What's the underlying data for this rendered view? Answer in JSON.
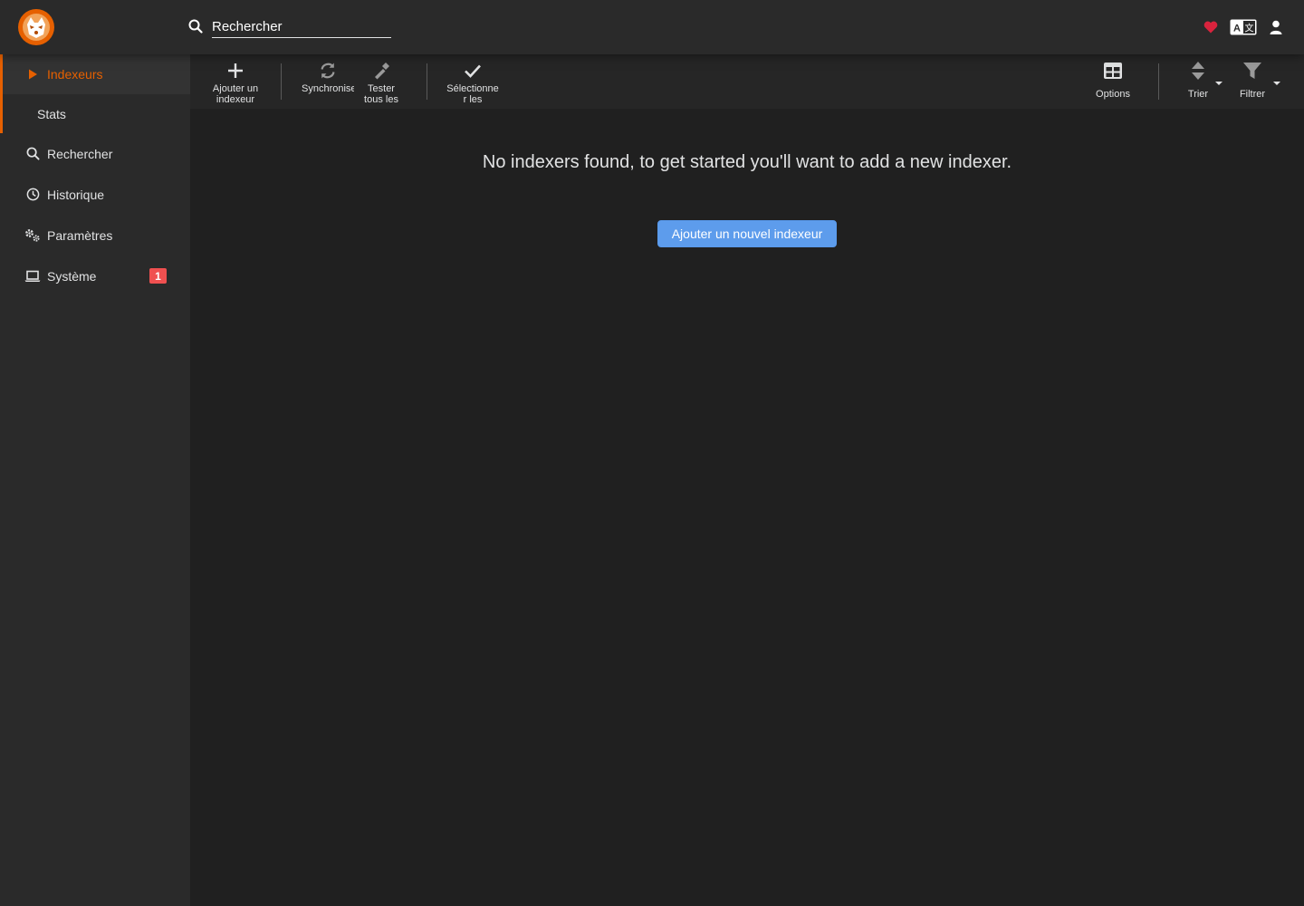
{
  "header": {
    "search_placeholder": "Rechercher",
    "icons": [
      "heart-icon",
      "translate-icon",
      "user-icon"
    ]
  },
  "sidebar": {
    "items": [
      {
        "label": "Indexeurs",
        "icon": "play-icon",
        "active": true
      },
      {
        "label": "Stats",
        "sub": true
      },
      {
        "label": "Rechercher",
        "icon": "search-icon"
      },
      {
        "label": "Historique",
        "icon": "clock-icon"
      },
      {
        "label": "Paramètres",
        "icon": "gears-icon"
      },
      {
        "label": "Système",
        "icon": "laptop-icon",
        "badge": "1"
      }
    ]
  },
  "toolbar": {
    "add": "Ajouter un indexeur",
    "sync": "Synchroniser les",
    "test": "Tester tous les",
    "select": "Sélectionner les",
    "options": "Options",
    "sort": "Trier",
    "filter": "Filtrer"
  },
  "main": {
    "empty_message": "No indexers found, to get started you'll want to add a new indexer.",
    "add_button": "Ajouter un nouvel indexeur"
  },
  "colors": {
    "accent": "#e66000",
    "primary_button": "#5d9cec",
    "badge": "#f05050",
    "heart": "#d9233d"
  }
}
